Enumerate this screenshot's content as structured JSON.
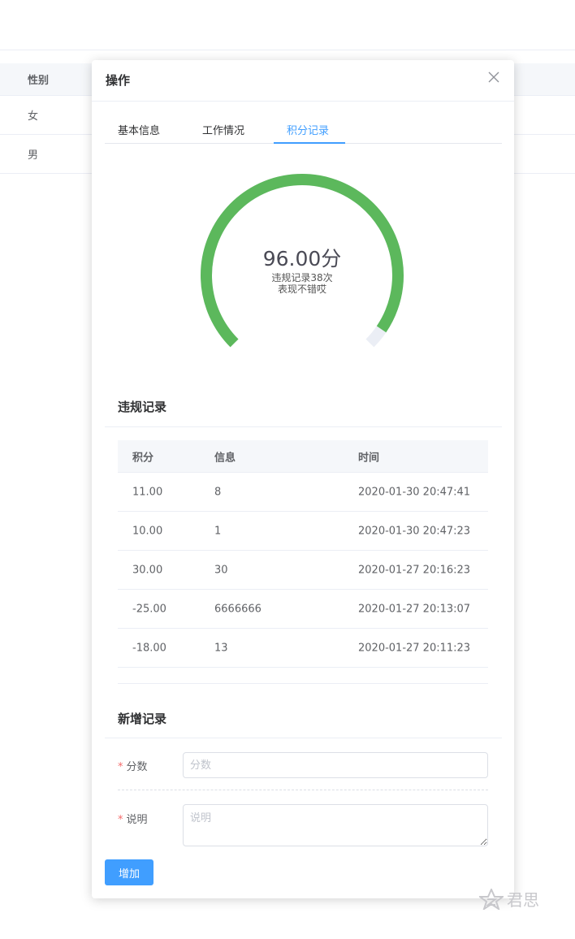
{
  "background": {
    "column_header": "性别",
    "rows": [
      "女",
      "男"
    ]
  },
  "dialog": {
    "title": "操作",
    "close_icon": "close-icon",
    "tabs": [
      {
        "label": "基本信息",
        "active": false
      },
      {
        "label": "工作情况",
        "active": false
      },
      {
        "label": "积分记录",
        "active": true
      }
    ]
  },
  "score": {
    "value_text": "96.00分",
    "line1": "违规记录38次",
    "line2": "表现不错哎",
    "progress_fraction": 0.96,
    "color": "#5cb85c"
  },
  "violations": {
    "title": "违规记录",
    "columns": [
      "积分",
      "信息",
      "时间"
    ],
    "rows": [
      {
        "points": "11.00",
        "info": "8",
        "time": "2020-01-30 20:47:41"
      },
      {
        "points": "10.00",
        "info": "1",
        "time": "2020-01-30 20:47:23"
      },
      {
        "points": "30.00",
        "info": "30",
        "time": "2020-01-27 20:16:23"
      },
      {
        "points": "-25.00",
        "info": "6666666",
        "time": "2020-01-27 20:13:07"
      },
      {
        "points": "-18.00",
        "info": "13",
        "time": "2020-01-27 20:11:23"
      }
    ]
  },
  "new_record": {
    "title": "新增记录",
    "score_label": "分数",
    "score_placeholder": "分数",
    "desc_label": "说明",
    "desc_placeholder": "说明",
    "required_mark": "*",
    "submit_label": "增加"
  },
  "watermark": {
    "text": "君思"
  },
  "colors": {
    "primary": "#409eff",
    "success": "#5cb85c",
    "required": "#f56c6c"
  }
}
